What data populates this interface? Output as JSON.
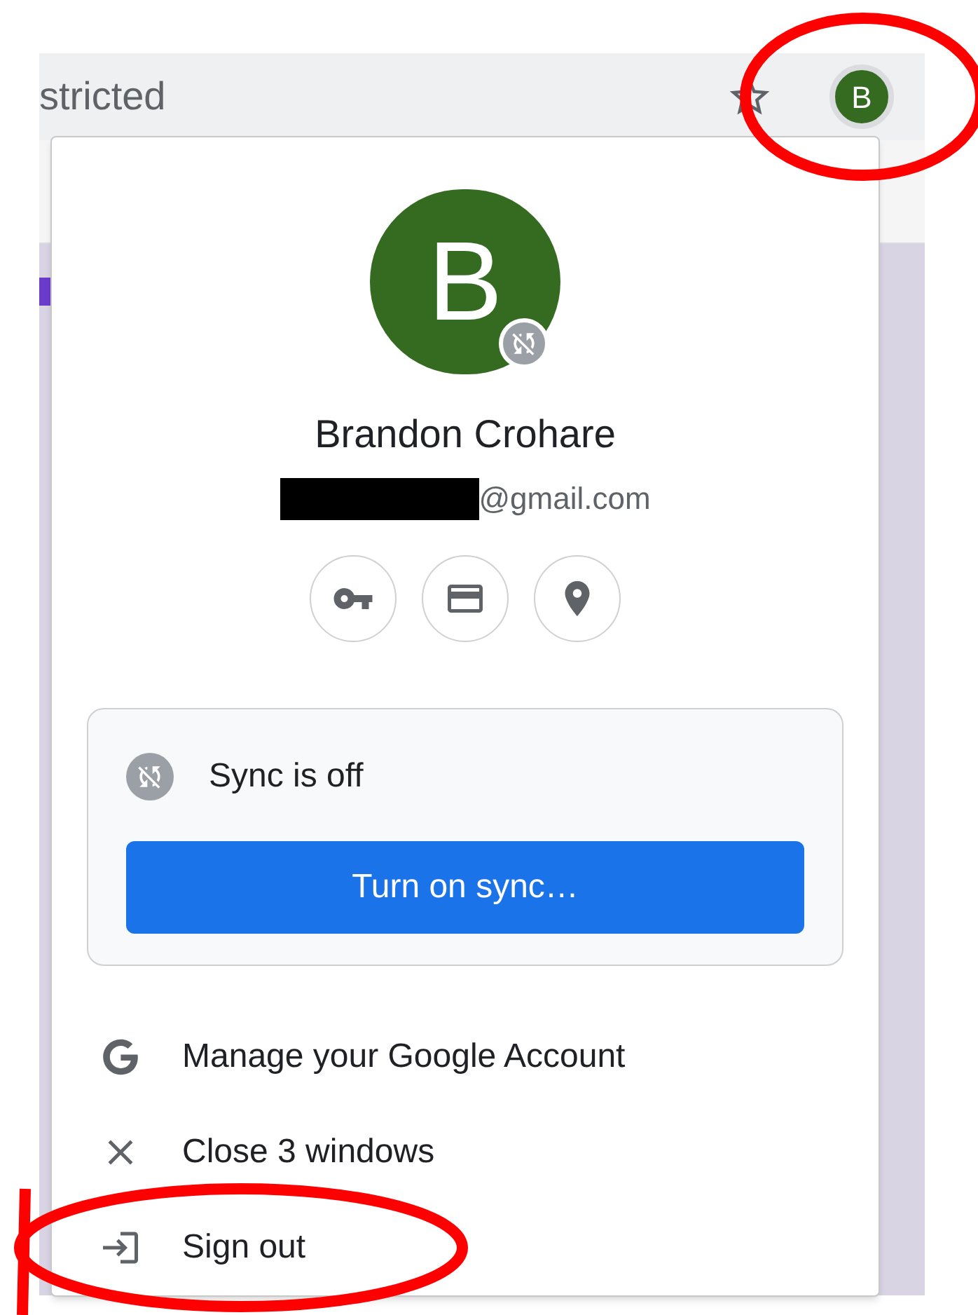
{
  "toolbar": {
    "address_text": "stricted",
    "profile_initial": "B"
  },
  "profile_menu": {
    "avatar_initial": "B",
    "name": "Brandon Crohare",
    "email_suffix": "@gmail.com",
    "sync": {
      "status": "Sync is off",
      "button": "Turn on sync…"
    },
    "items": [
      {
        "kind": "google",
        "label": "Manage your Google Account"
      },
      {
        "kind": "close",
        "label": "Close 3 windows"
      },
      {
        "kind": "signout",
        "label": "Sign out"
      }
    ]
  }
}
